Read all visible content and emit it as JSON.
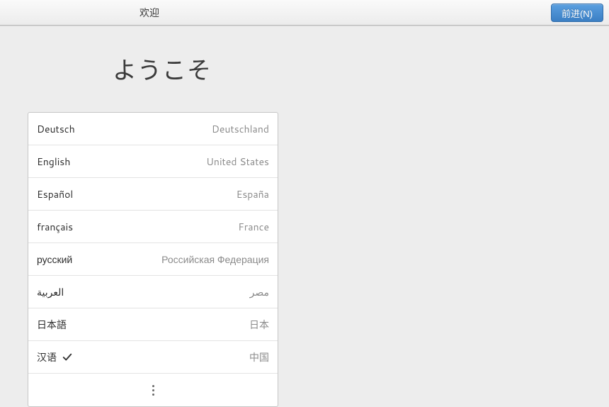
{
  "header": {
    "title": "欢迎",
    "forward_label": "前进(N)"
  },
  "welcome_heading": "ようこそ",
  "selected_index": 7,
  "languages": [
    {
      "name": "Deutsch",
      "country": "Deutschland"
    },
    {
      "name": "English",
      "country": "United States"
    },
    {
      "name": "Español",
      "country": "España"
    },
    {
      "name": "français",
      "country": "France"
    },
    {
      "name": "русский",
      "country": "Российская Федерация"
    },
    {
      "name": "العربية",
      "country": "مصر"
    },
    {
      "name": "日本語",
      "country": "日本"
    },
    {
      "name": "汉语",
      "country": "中国"
    }
  ]
}
